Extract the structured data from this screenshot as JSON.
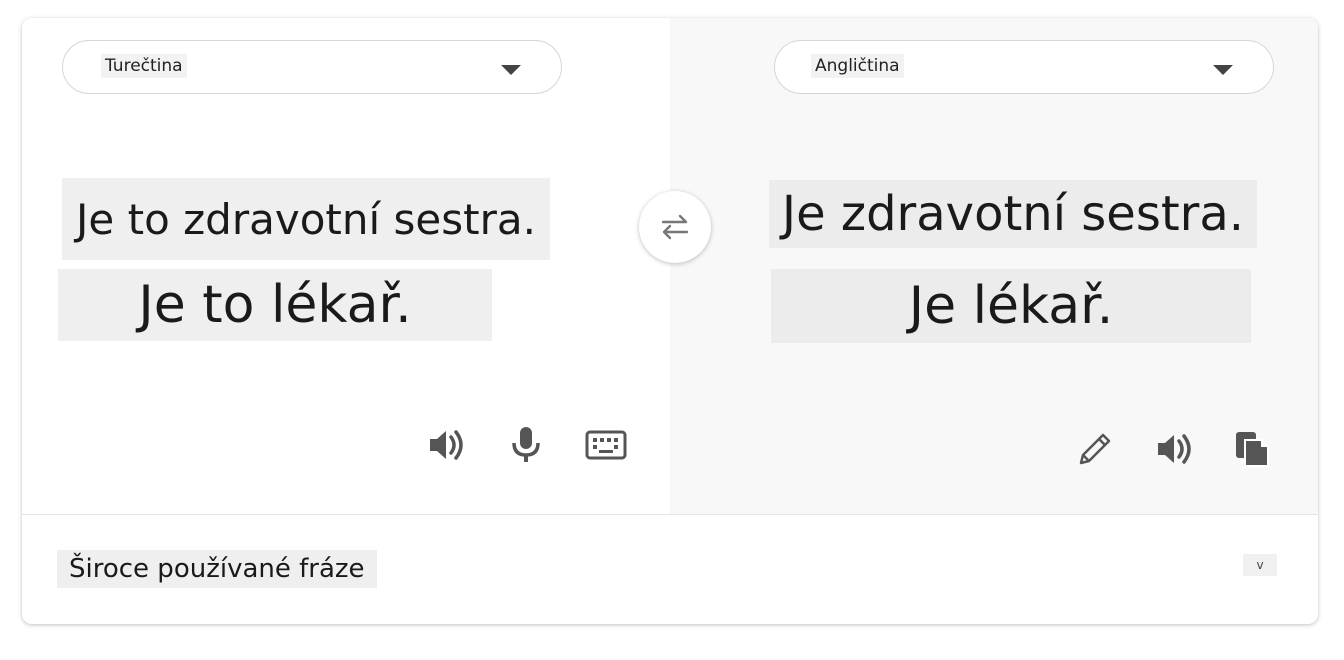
{
  "source": {
    "language": "Turečtina",
    "phrases": [
      "Je to zdravotní sestra.",
      "Je to lékař."
    ]
  },
  "target": {
    "language": "Angličtina",
    "phrases": [
      "Je zdravotní sestra.",
      "Je lékař."
    ]
  },
  "footer": {
    "label": "Široce používané fráze",
    "expand_glyph": "v"
  },
  "icons": {
    "swap": "swap-arrows-icon",
    "source_tools": [
      "speaker-icon",
      "microphone-icon",
      "keyboard-icon"
    ],
    "target_tools": [
      "pencil-icon",
      "speaker-icon",
      "copy-icon"
    ]
  },
  "colors": {
    "border": "#d6d6d6",
    "right_pane_bg": "#f8f8f8",
    "phrase_highlight": "#efefef",
    "icon": "#555555"
  }
}
